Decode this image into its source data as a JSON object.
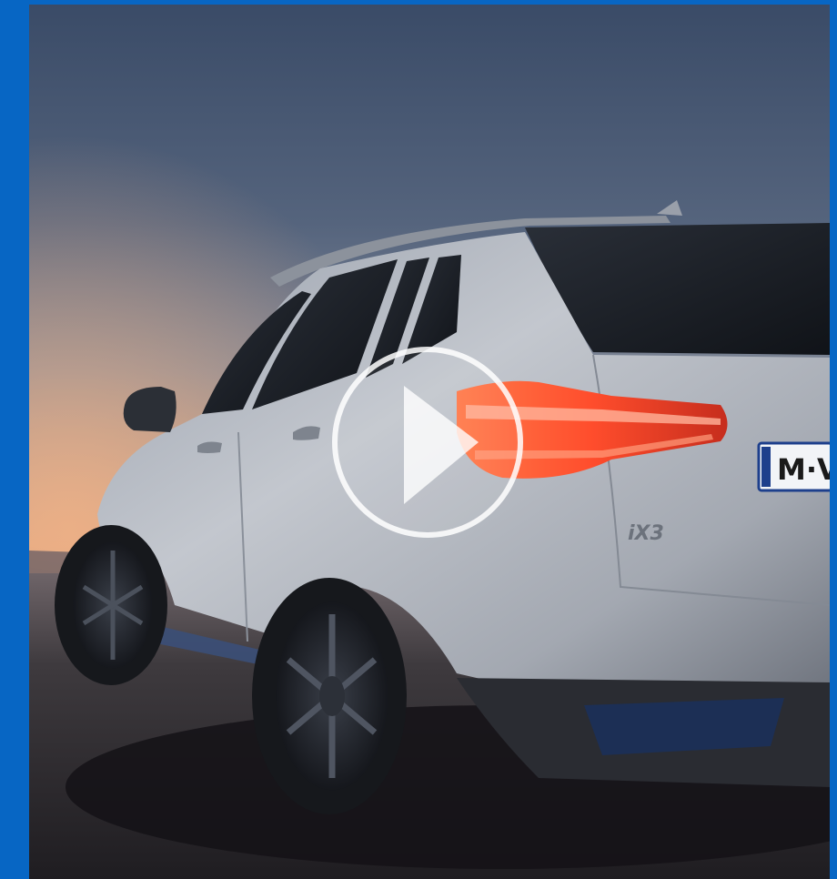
{
  "video": {
    "title": "",
    "plate_text": "M·V",
    "badge_text": "iX3",
    "state": "paused"
  },
  "colors": {
    "frame": "#0766c4",
    "sky_top": "#3b4d69",
    "sky_mid": "#6d7a8e",
    "horizon_glow": "#e0a27f",
    "ground": "#2c2a2e",
    "car_body": "#b7bcc4",
    "taillight": "#ff5636",
    "play_ring": "#ffffff"
  },
  "icons": {
    "play": "play-icon"
  }
}
